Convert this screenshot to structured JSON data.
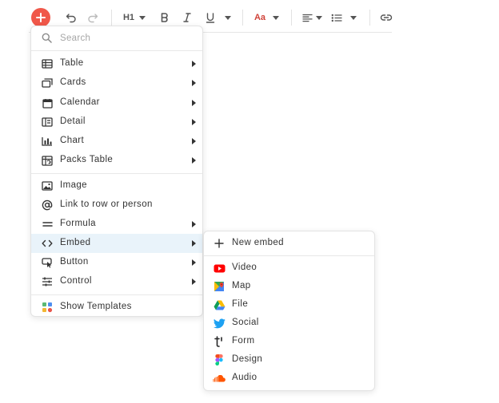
{
  "search": {
    "placeholder": "Search",
    "value": ""
  },
  "toolbar": {
    "heading_label": "H1",
    "font_label": "Aa",
    "accent": "#f0584a"
  },
  "menu": {
    "groups": [
      [
        {
          "label": "Table",
          "icon": "table-icon",
          "submenu": true
        },
        {
          "label": "Cards",
          "icon": "cards-icon",
          "submenu": true
        },
        {
          "label": "Calendar",
          "icon": "calendar-icon",
          "submenu": true
        },
        {
          "label": "Detail",
          "icon": "detail-icon",
          "submenu": true
        },
        {
          "label": "Chart",
          "icon": "chart-icon",
          "submenu": true
        },
        {
          "label": "Packs Table",
          "icon": "packs-table-icon",
          "submenu": true
        }
      ],
      [
        {
          "label": "Image",
          "icon": "image-icon",
          "submenu": false
        },
        {
          "label": "Link to row or person",
          "icon": "at-icon",
          "submenu": false
        },
        {
          "label": "Formula",
          "icon": "formula-icon",
          "submenu": true
        },
        {
          "label": "Embed",
          "icon": "embed-icon",
          "submenu": true,
          "active": true
        },
        {
          "label": "Button",
          "icon": "button-icon",
          "submenu": true
        },
        {
          "label": "Control",
          "icon": "control-icon",
          "submenu": true
        }
      ],
      [
        {
          "label": "Show Templates",
          "icon": "templates-icon",
          "submenu": false
        }
      ]
    ]
  },
  "embed_submenu": {
    "new_embed": "New embed",
    "items": [
      {
        "label": "Video",
        "icon": "youtube-icon"
      },
      {
        "label": "Map",
        "icon": "google-maps-icon"
      },
      {
        "label": "File",
        "icon": "google-drive-icon"
      },
      {
        "label": "Social",
        "icon": "twitter-icon"
      },
      {
        "label": "Form",
        "icon": "typeform-icon"
      },
      {
        "label": "Design",
        "icon": "figma-icon"
      },
      {
        "label": "Audio",
        "icon": "soundcloud-icon"
      }
    ]
  }
}
